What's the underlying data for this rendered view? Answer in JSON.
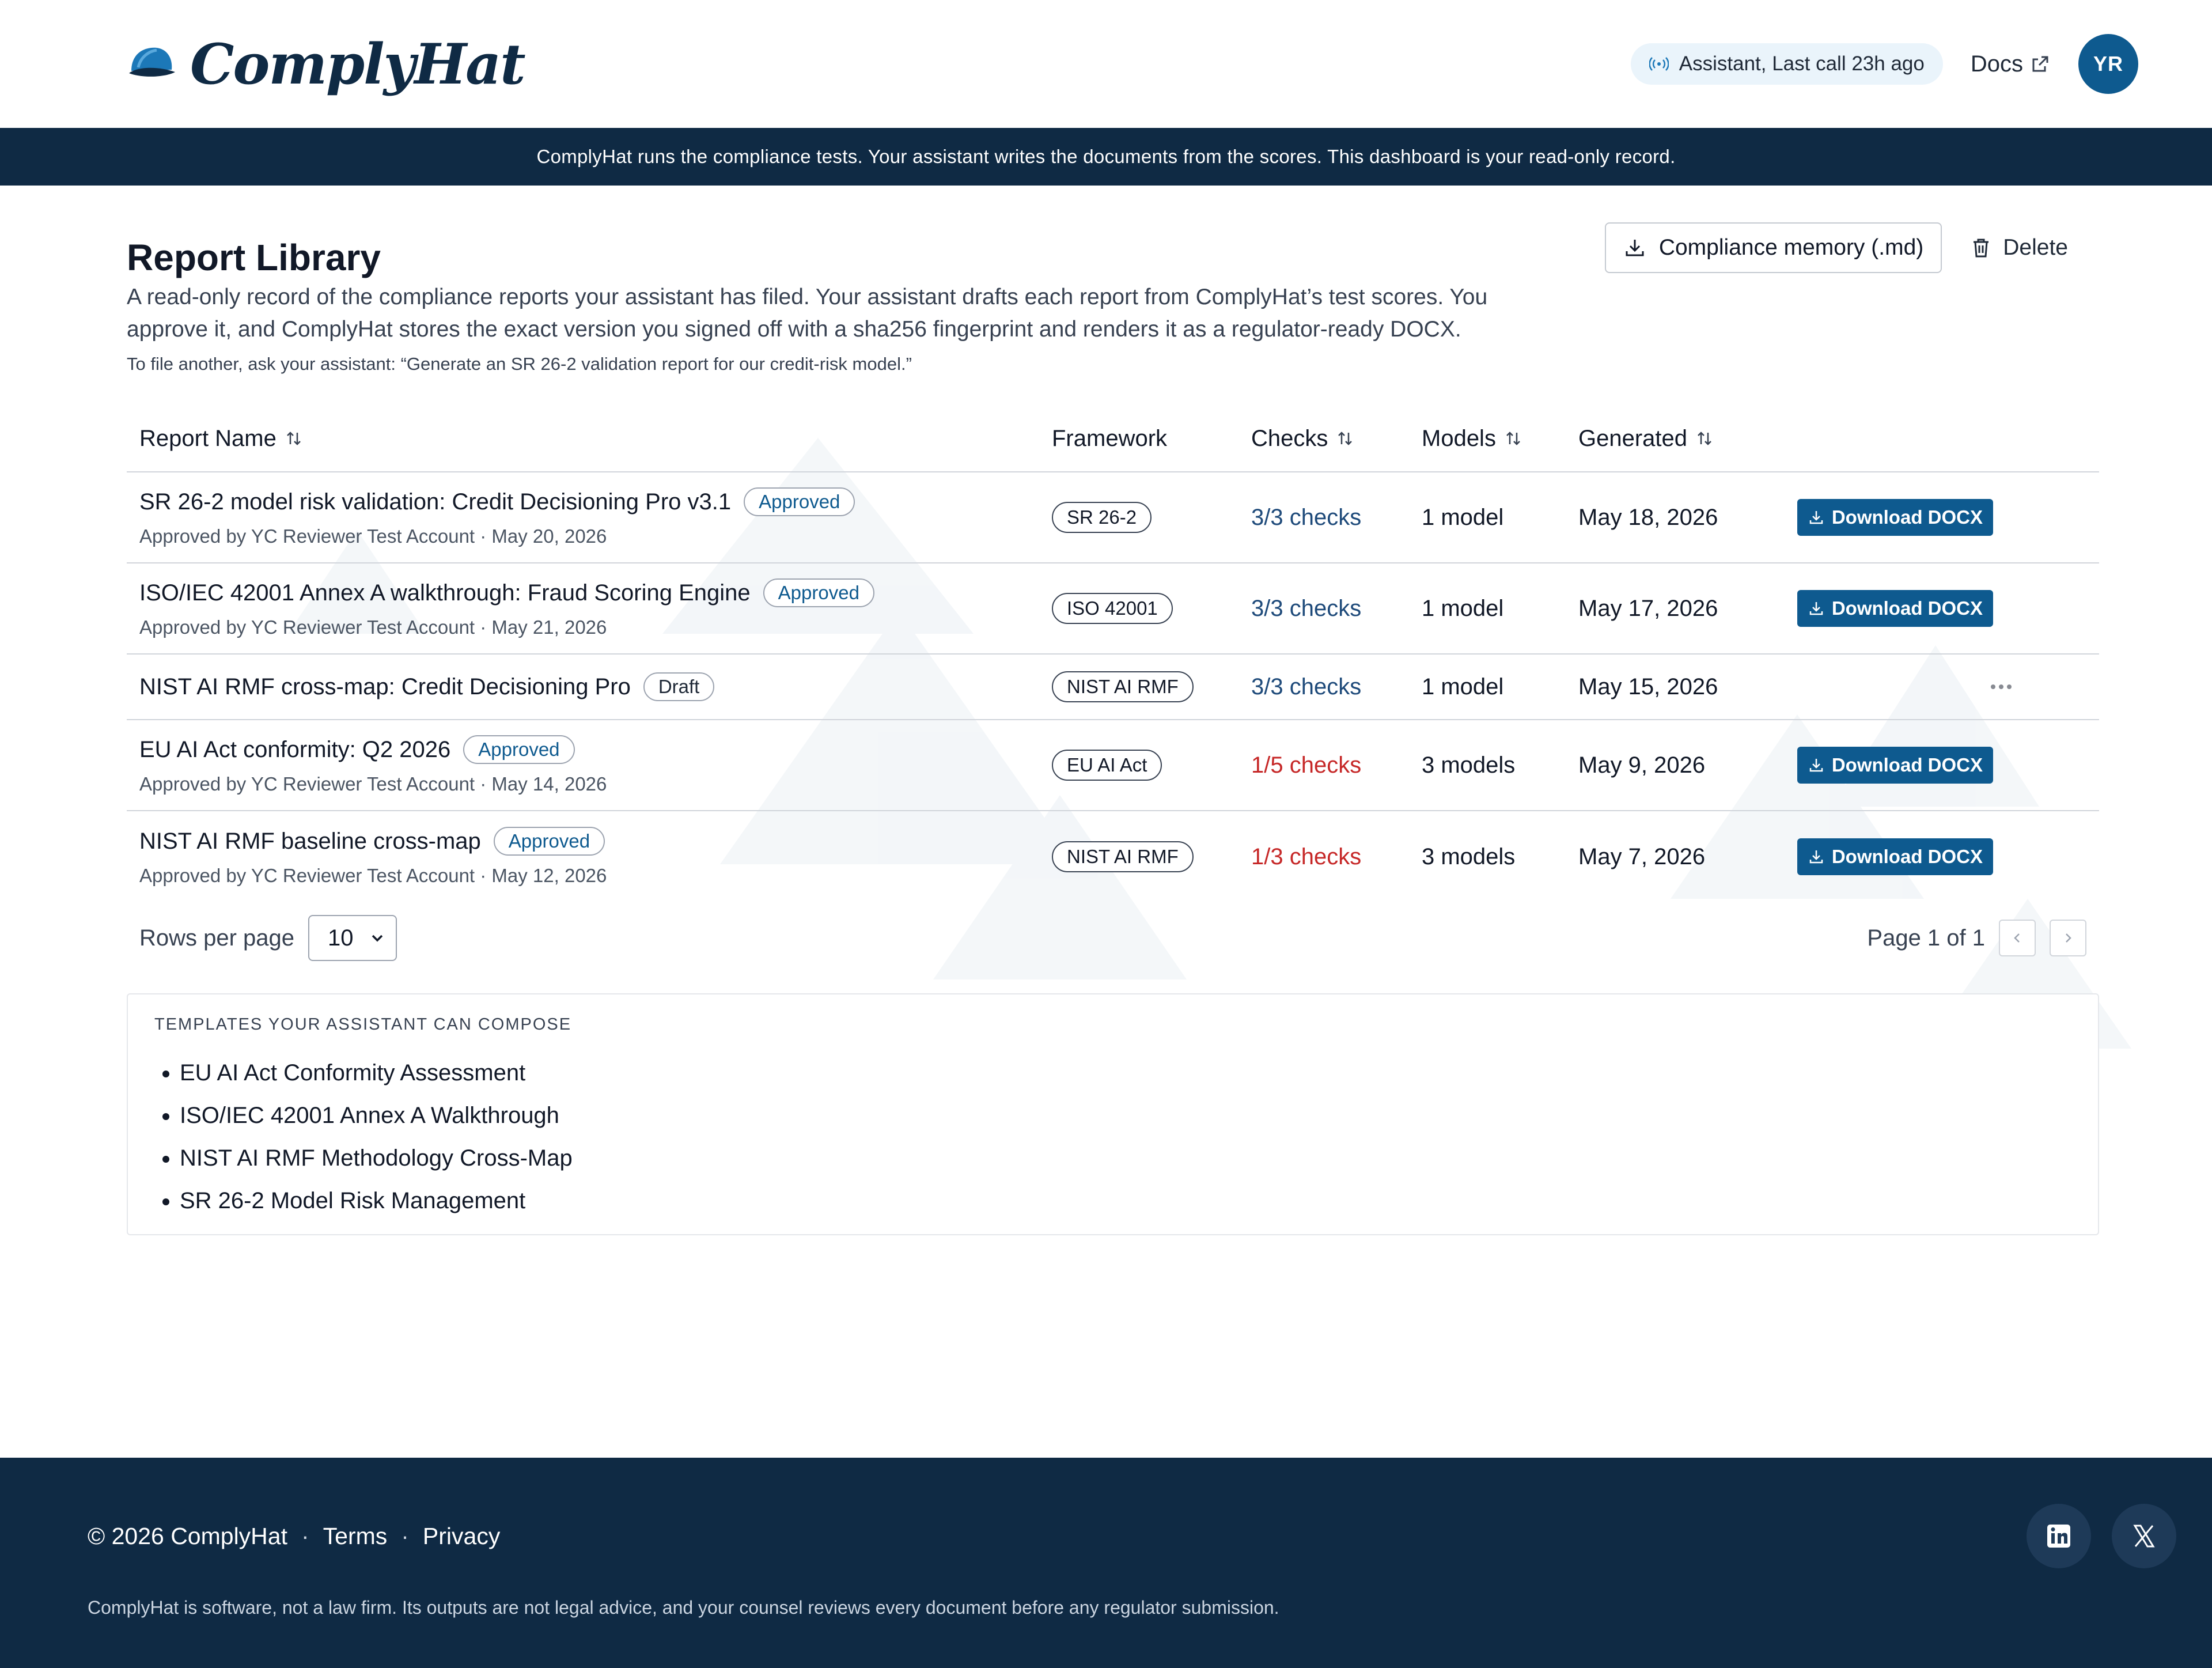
{
  "brand": {
    "name": "ComplyHat"
  },
  "header": {
    "status": "Assistant, Last call 23h ago",
    "docs_label": "Docs",
    "avatar_initials": "YR"
  },
  "banner": {
    "text": "ComplyHat runs the compliance tests. Your assistant writes the documents from the scores. This dashboard is your read-only record."
  },
  "page": {
    "title": "Report Library",
    "memory_button": "Compliance memory (.md)",
    "delete_button": "Delete",
    "intro": "A read-only record of the compliance reports your assistant has filed. Your assistant drafts each report from ComplyHat’s test scores. You approve it, and ComplyHat stores the exact version you signed off with a sha256 fingerprint and renders it as a regulator-ready DOCX.",
    "hint": "To file another, ask your assistant: “Generate an SR 26-2 validation report for our credit-risk model.”"
  },
  "table": {
    "columns": {
      "name": "Report Name",
      "framework": "Framework",
      "checks": "Checks",
      "models": "Models",
      "generated": "Generated"
    },
    "download_label": "Download DOCX",
    "rows": [
      {
        "name": "SR 26-2 model risk validation: Credit Decisioning Pro v3.1",
        "status": "Approved",
        "approved_by": "Approved by YC Reviewer Test Account · May 20, 2026",
        "framework": "SR 26-2",
        "checks": "3/3 checks",
        "models": "1 model",
        "generated": "May 18, 2026"
      },
      {
        "name": "ISO/IEC 42001 Annex A walkthrough: Fraud Scoring Engine",
        "status": "Approved",
        "approved_by": "Approved by YC Reviewer Test Account · May 21, 2026",
        "framework": "ISO 42001",
        "checks": "3/3 checks",
        "models": "1 model",
        "generated": "May 17, 2026"
      },
      {
        "name": "NIST AI RMF cross-map: Credit Decisioning Pro",
        "status": "Draft",
        "framework": "NIST AI RMF",
        "checks": "3/3 checks",
        "models": "1 model",
        "generated": "May 15, 2026"
      },
      {
        "name": "EU AI Act conformity: Q2 2026",
        "status": "Approved",
        "approved_by": "Approved by YC Reviewer Test Account · May 14, 2026",
        "framework": "EU AI Act",
        "checks": "1/5 checks",
        "models": "3 models",
        "generated": "May 9, 2026"
      },
      {
        "name": "NIST AI RMF baseline cross-map",
        "status": "Approved",
        "approved_by": "Approved by YC Reviewer Test Account · May 12, 2026",
        "framework": "NIST AI RMF",
        "checks": "1/3 checks",
        "models": "3 models",
        "generated": "May 7, 2026"
      }
    ]
  },
  "pagination": {
    "rows_per_page_label": "Rows per page",
    "rows_per_page_value": "10",
    "page_label": "Page 1 of 1"
  },
  "templates": {
    "title": "TEMPLATES YOUR ASSISTANT CAN COMPOSE",
    "items": [
      "EU AI Act Conformity Assessment",
      "ISO/IEC 42001 Annex A Walkthrough",
      "NIST AI RMF Methodology Cross-Map",
      "SR 26-2 Model Risk Management"
    ]
  },
  "footer": {
    "copyright": "© 2026 ComplyHat",
    "terms": "Terms",
    "privacy": "Privacy",
    "disclaimer": "ComplyHat is software, not a law firm. Its outputs are not legal advice, and your counsel reviews every document before any regulator submission."
  },
  "colors": {
    "navy": "#0f2a44",
    "accent_blue": "#0e5a8f",
    "fail_red": "#c62828",
    "pass_blue": "#1e4a7a"
  },
  "icons": {
    "logo": "baseball-cap-icon",
    "status": "broadcast-icon",
    "docs": "external-link-icon",
    "memory": "download-icon",
    "delete": "trash-icon",
    "sort": "sort-arrows-icon",
    "row_menu": "more-horizontal-icon",
    "linkedin": "linkedin-icon",
    "x": "x-logo-icon"
  }
}
